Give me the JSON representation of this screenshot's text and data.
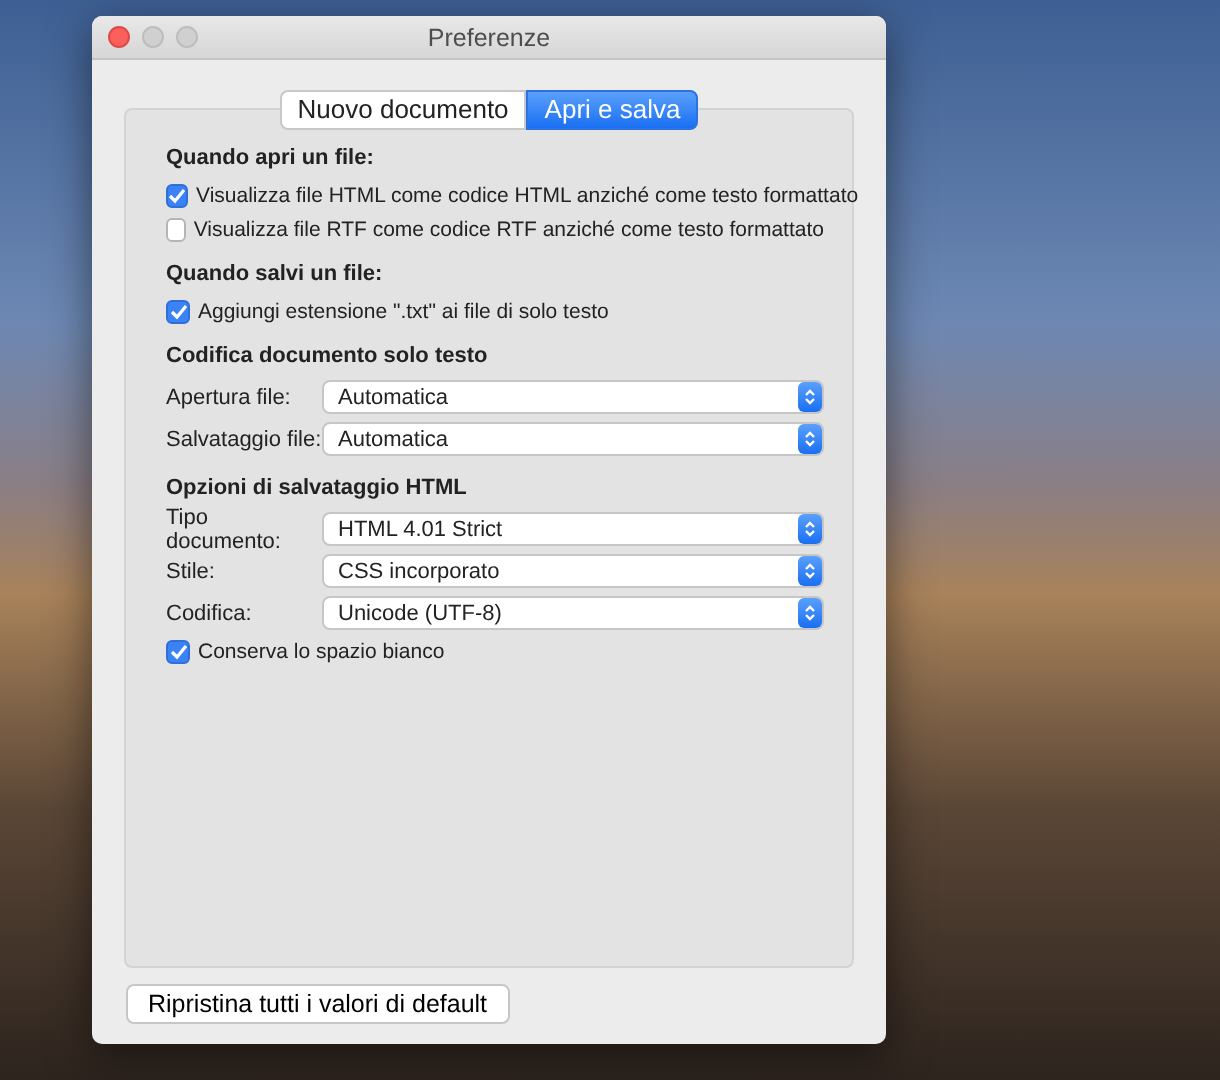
{
  "window": {
    "title": "Preferenze"
  },
  "tabs": [
    {
      "label": "Nuovo documento",
      "selected": false
    },
    {
      "label": "Apri e salva",
      "selected": true
    }
  ],
  "sections": [
    {
      "heading": "Quando apri un file:",
      "items": [
        {
          "kind": "checkbox",
          "label": "Visualizza file HTML come codice HTML anziché come testo formattato",
          "checked": true
        },
        {
          "kind": "checkbox",
          "label": "Visualizza file RTF come codice RTF anziché come testo formattato",
          "checked": false
        }
      ]
    },
    {
      "heading": "Quando salvi un file:",
      "items": [
        {
          "kind": "checkbox",
          "label": "Aggiungi estensione \".txt\" ai file di solo testo",
          "checked": true
        }
      ]
    },
    {
      "heading": "Codifica documento solo testo",
      "items": [
        {
          "kind": "select",
          "label": "Apertura file:",
          "value": "Automatica"
        },
        {
          "kind": "select",
          "label": "Salvataggio file:",
          "value": "Automatica"
        }
      ]
    },
    {
      "heading": "Opzioni di salvataggio HTML",
      "items": [
        {
          "kind": "select",
          "label": "Tipo documento:",
          "value": "HTML 4.01 Strict"
        },
        {
          "kind": "select",
          "label": "Stile:",
          "value": "CSS incorporato"
        },
        {
          "kind": "select",
          "label": "Codifica:",
          "value": "Unicode (UTF-8)"
        },
        {
          "kind": "checkbox",
          "label": "Conserva lo spazio bianco",
          "checked": true
        }
      ]
    }
  ],
  "reset_button": "Ripristina tutti i valori di default"
}
